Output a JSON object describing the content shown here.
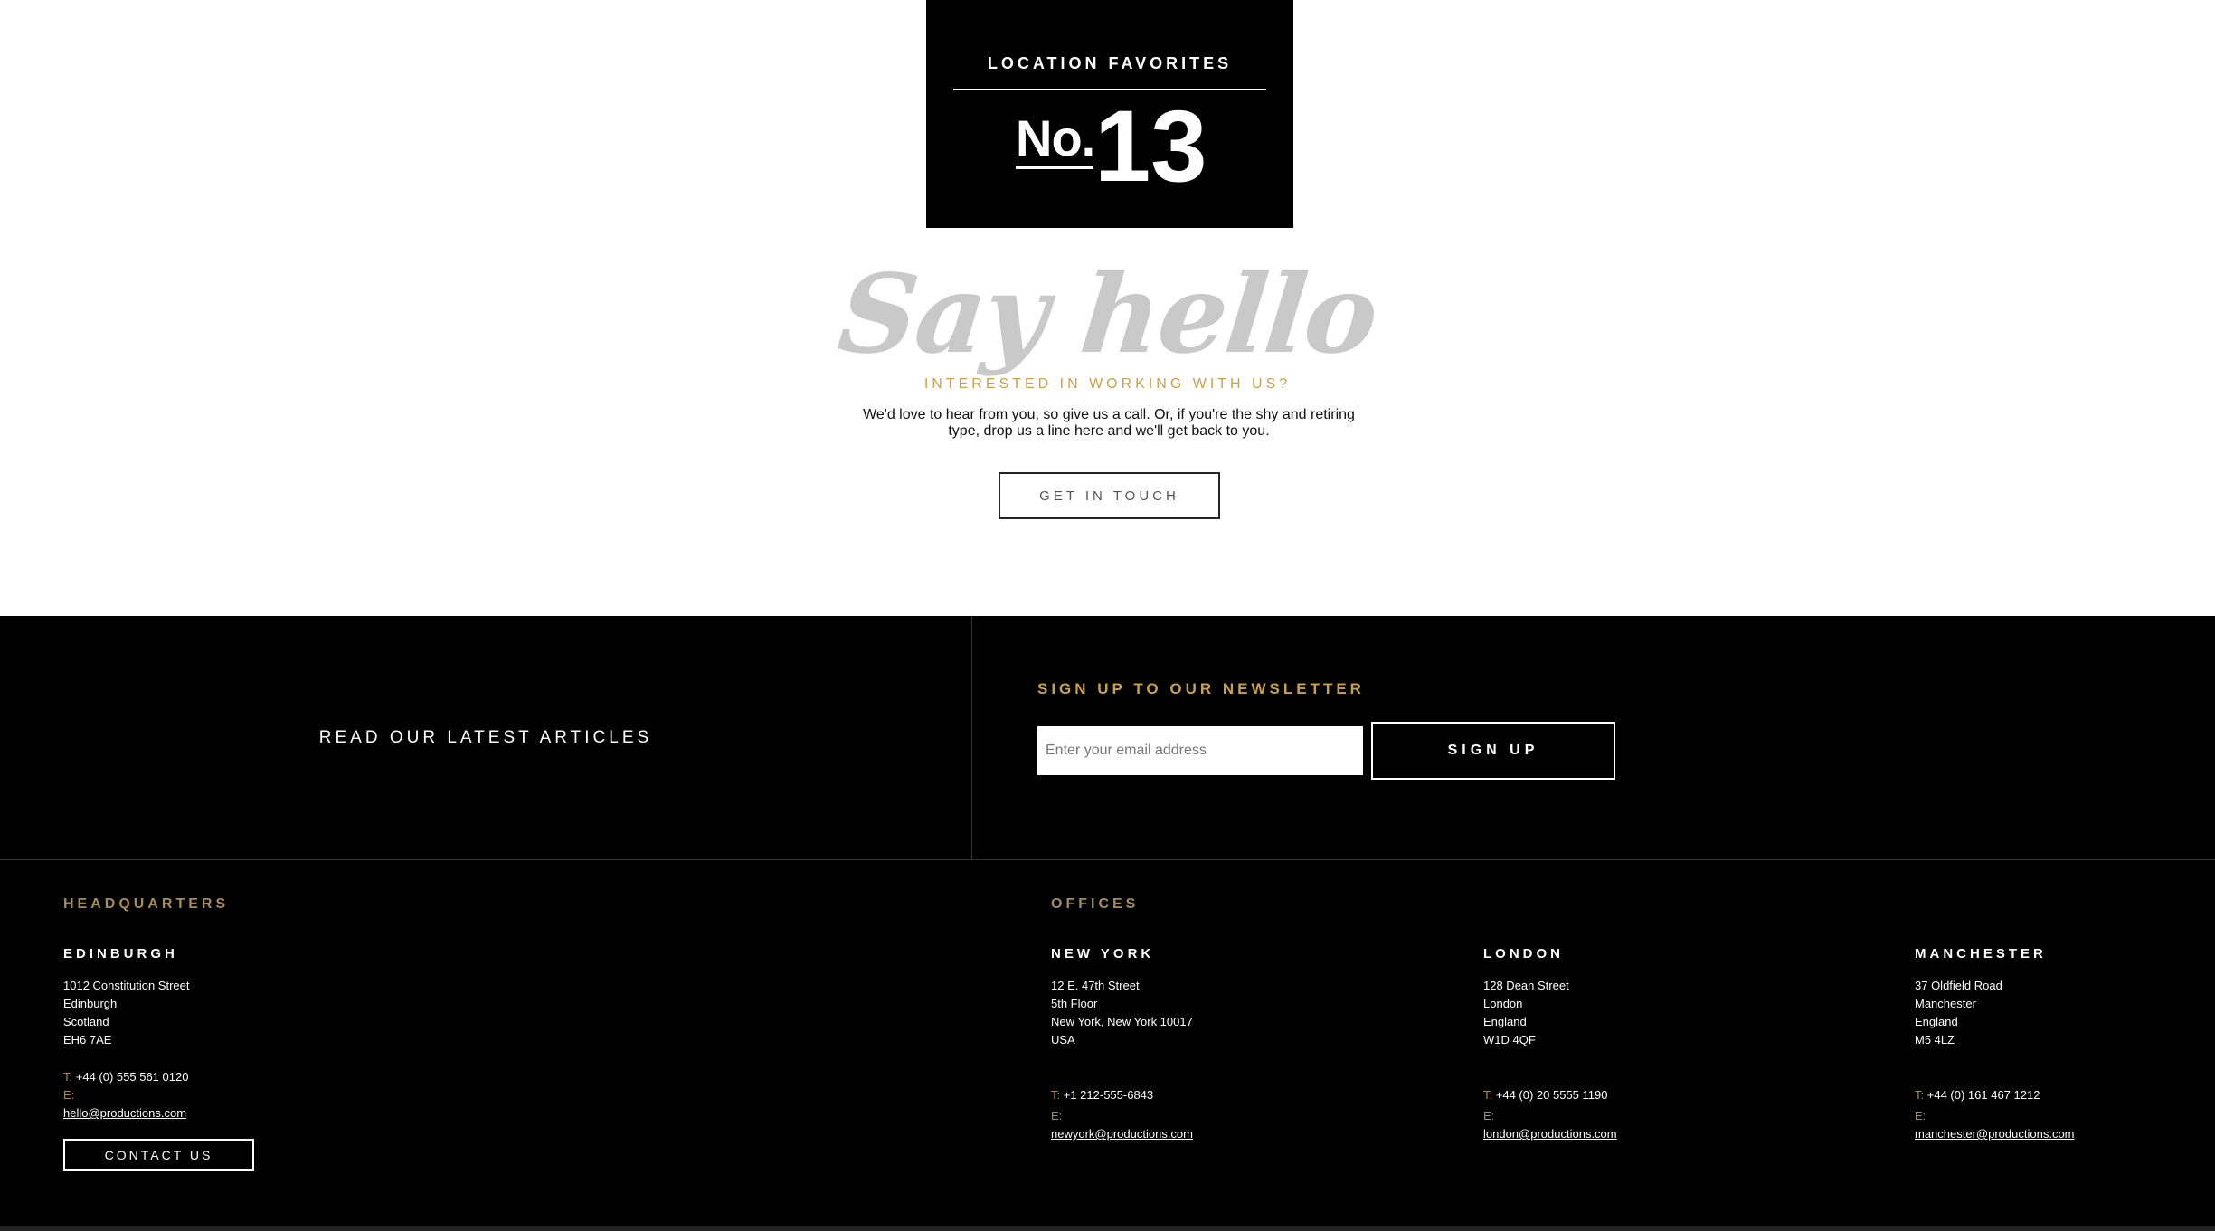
{
  "badge": {
    "title": "LOCATION FAVORITES",
    "no_label": "No.",
    "number": "13"
  },
  "hello": {
    "heading": "Say hello",
    "subheading": "INTERESTED IN WORKING WITH US?",
    "intro": "We'd love to hear from you, so give us a call. Or, if you're the shy and retiring type, drop us a line here and we'll get back to you.",
    "button": "GET IN TOUCH"
  },
  "footer": {
    "articles_link": "READ OUR LATEST ARTICLES",
    "newsletter": {
      "title": "SIGN UP TO OUR NEWSLETTER",
      "placeholder": "Enter your email address",
      "button": "SIGN UP"
    },
    "headquarters": {
      "title": "HEADQUARTERS",
      "city": "EDINBURGH",
      "address": [
        "1012 Constitution Street",
        "Edinburgh",
        "Scotland",
        "EH6 7AE"
      ],
      "phone_label": "T:",
      "phone": "+44 (0) 555 561 0120",
      "email_label": "E:",
      "email": "hello@productions.com",
      "button": "CONTACT US"
    },
    "offices": {
      "title": "OFFICES",
      "items": [
        {
          "city": "NEW YORK",
          "address": [
            "12 E. 47th Street",
            "5th Floor",
            "New York, New York 10017",
            "USA"
          ],
          "phone_label": "T:",
          "phone": "+1 212-555-6843",
          "email_label": "E:",
          "email": "newyork@productions.com"
        },
        {
          "city": "LONDON",
          "address": [
            "128 Dean Street",
            "London",
            "England",
            "W1D 4QF"
          ],
          "phone_label": "T:",
          "phone": "+44 (0) 20 5555 1190",
          "email_label": "E:",
          "email": "london@productions.com"
        },
        {
          "city": "MANCHESTER",
          "address": [
            "37 Oldfield Road",
            "Manchester",
            "England",
            "M5 4LZ"
          ],
          "phone_label": "T:",
          "phone": "+44 (0) 161 467 1212",
          "email_label": "E:",
          "email": "manchester@productions.com"
        }
      ]
    }
  },
  "colors": {
    "accent_gold": "#a58c58",
    "subheading_gold": "#c9a14a",
    "footer_bg": "#000000",
    "hello_gray": "#c9c9c9"
  }
}
